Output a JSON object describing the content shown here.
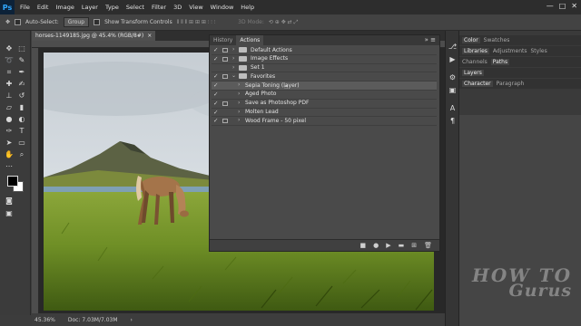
{
  "menubar": {
    "logo": "Ps",
    "items": [
      "File",
      "Edit",
      "Image",
      "Layer",
      "Type",
      "Select",
      "Filter",
      "3D",
      "View",
      "Window",
      "Help"
    ],
    "window_controls": [
      "—",
      "□",
      "✕"
    ]
  },
  "options_bar": {
    "auto_select_label": "Auto-Select:",
    "auto_select_value": "Group",
    "transform_label": "Show Transform Controls",
    "mode_3d_label": "3D Mode:"
  },
  "document": {
    "tab_title": "horses-1149185.jpg @ 45.4% (RGB/8#)",
    "tab_close": "×",
    "zoom": "45.36%",
    "doc_info": "Doc: 7.03M/7.03M",
    "status_arrow": "›"
  },
  "actions_panel": {
    "tabs": [
      "History",
      "Actions"
    ],
    "menu_glyph": "»  ≡",
    "rows": [
      {
        "label": "Default Actions",
        "type": "set",
        "expanded": false,
        "toggle": true
      },
      {
        "label": "Image Effects",
        "type": "set",
        "expanded": false,
        "toggle": true
      },
      {
        "label": "Set 1",
        "type": "set",
        "expanded": false,
        "toggle": false
      },
      {
        "label": "Favorites",
        "type": "set",
        "expanded": true,
        "toggle": true
      },
      {
        "label": "Sepia Toning (layer)",
        "type": "action",
        "selected": true,
        "toggle": true
      },
      {
        "label": "Aged Photo",
        "type": "action",
        "toggle": true
      },
      {
        "label": "Save as Photoshop PDF",
        "type": "action",
        "toggle": true
      },
      {
        "label": "Molten Lead",
        "type": "action",
        "toggle": true
      },
      {
        "label": "Wood Frame - 50 pixel",
        "type": "action",
        "toggle": true
      }
    ]
  },
  "right_panels": {
    "group1": [
      "Color",
      "Swatches"
    ],
    "group2": [
      "Libraries",
      "Adjustments",
      "Styles"
    ],
    "group3": [
      "Channels",
      "Paths"
    ],
    "group4": [
      "Layers"
    ],
    "group5": [
      "Character",
      "Paragraph"
    ]
  },
  "watermark": {
    "line1": "HOW TO",
    "line2": "Gurus"
  },
  "colors": {
    "foreground": "#000000",
    "background": "#ffffff",
    "accent": "#31a8ff"
  }
}
